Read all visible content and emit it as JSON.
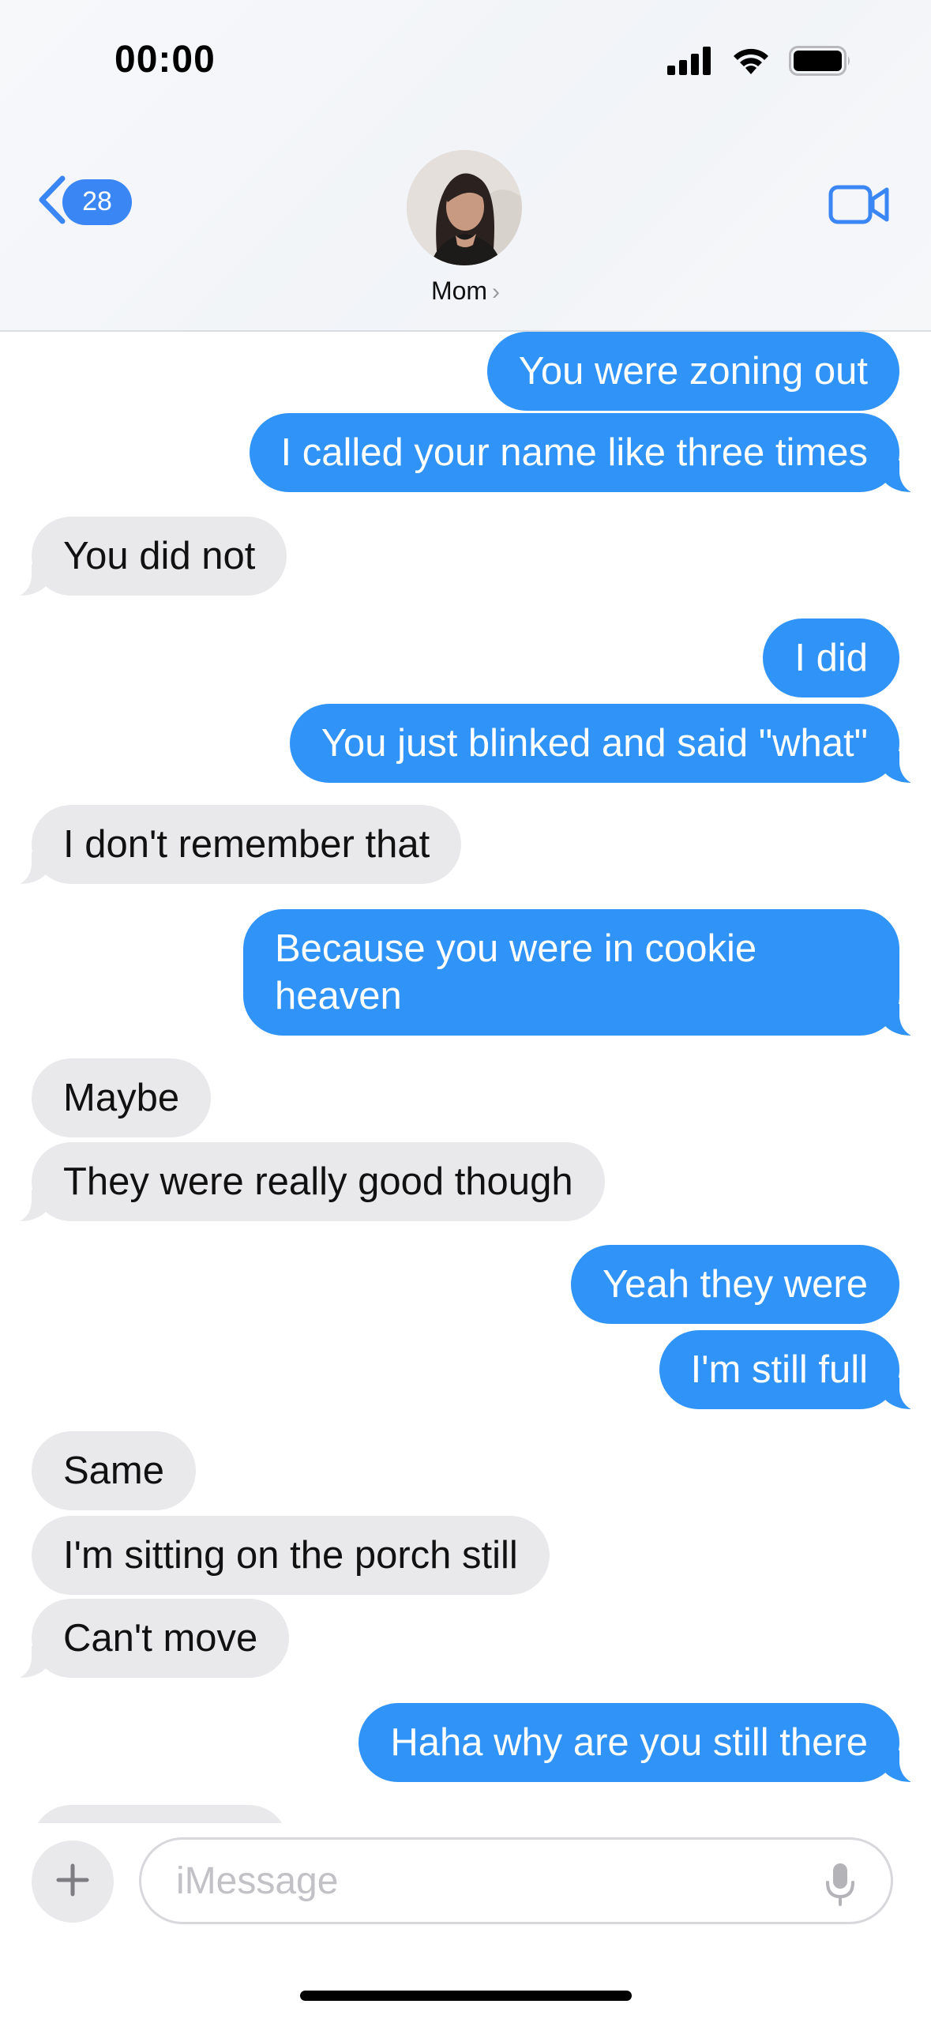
{
  "status_bar": {
    "time": "00:00"
  },
  "header": {
    "unread_count": "28",
    "contact_name": "Mom",
    "chevron": "›"
  },
  "messages": [
    {
      "dir": "sent",
      "text": "You were zoning out"
    },
    {
      "dir": "sent",
      "text": "I called your name like three times"
    },
    {
      "dir": "recv",
      "text": "You did not"
    },
    {
      "dir": "sent",
      "text": "I did"
    },
    {
      "dir": "sent",
      "text": "You just blinked and said \"what\""
    },
    {
      "dir": "recv",
      "text": "I don't remember that"
    },
    {
      "dir": "sent",
      "text": "Because you were in cookie heaven"
    },
    {
      "dir": "recv",
      "text": "Maybe"
    },
    {
      "dir": "recv",
      "text": "They were really good though"
    },
    {
      "dir": "sent",
      "text": "Yeah they were"
    },
    {
      "dir": "sent",
      "text": "I'm still full"
    },
    {
      "dir": "recv",
      "text": "Same"
    },
    {
      "dir": "recv",
      "text": "I'm sitting on the porch still"
    },
    {
      "dir": "recv",
      "text": "Can't move"
    },
    {
      "dir": "sent",
      "text": "Haha why are you still there"
    }
  ],
  "composer": {
    "placeholder": "iMessage"
  },
  "colors": {
    "sent_bubble": "#3093f8",
    "recv_bubble": "#e9e9eb",
    "accent": "#3a86f5"
  },
  "icons": {
    "back": "chevron-left-icon",
    "video": "video-camera-icon",
    "plus": "plus-icon",
    "mic": "microphone-icon",
    "signal": "cellular-signal-icon",
    "wifi": "wifi-icon",
    "battery": "battery-icon"
  }
}
